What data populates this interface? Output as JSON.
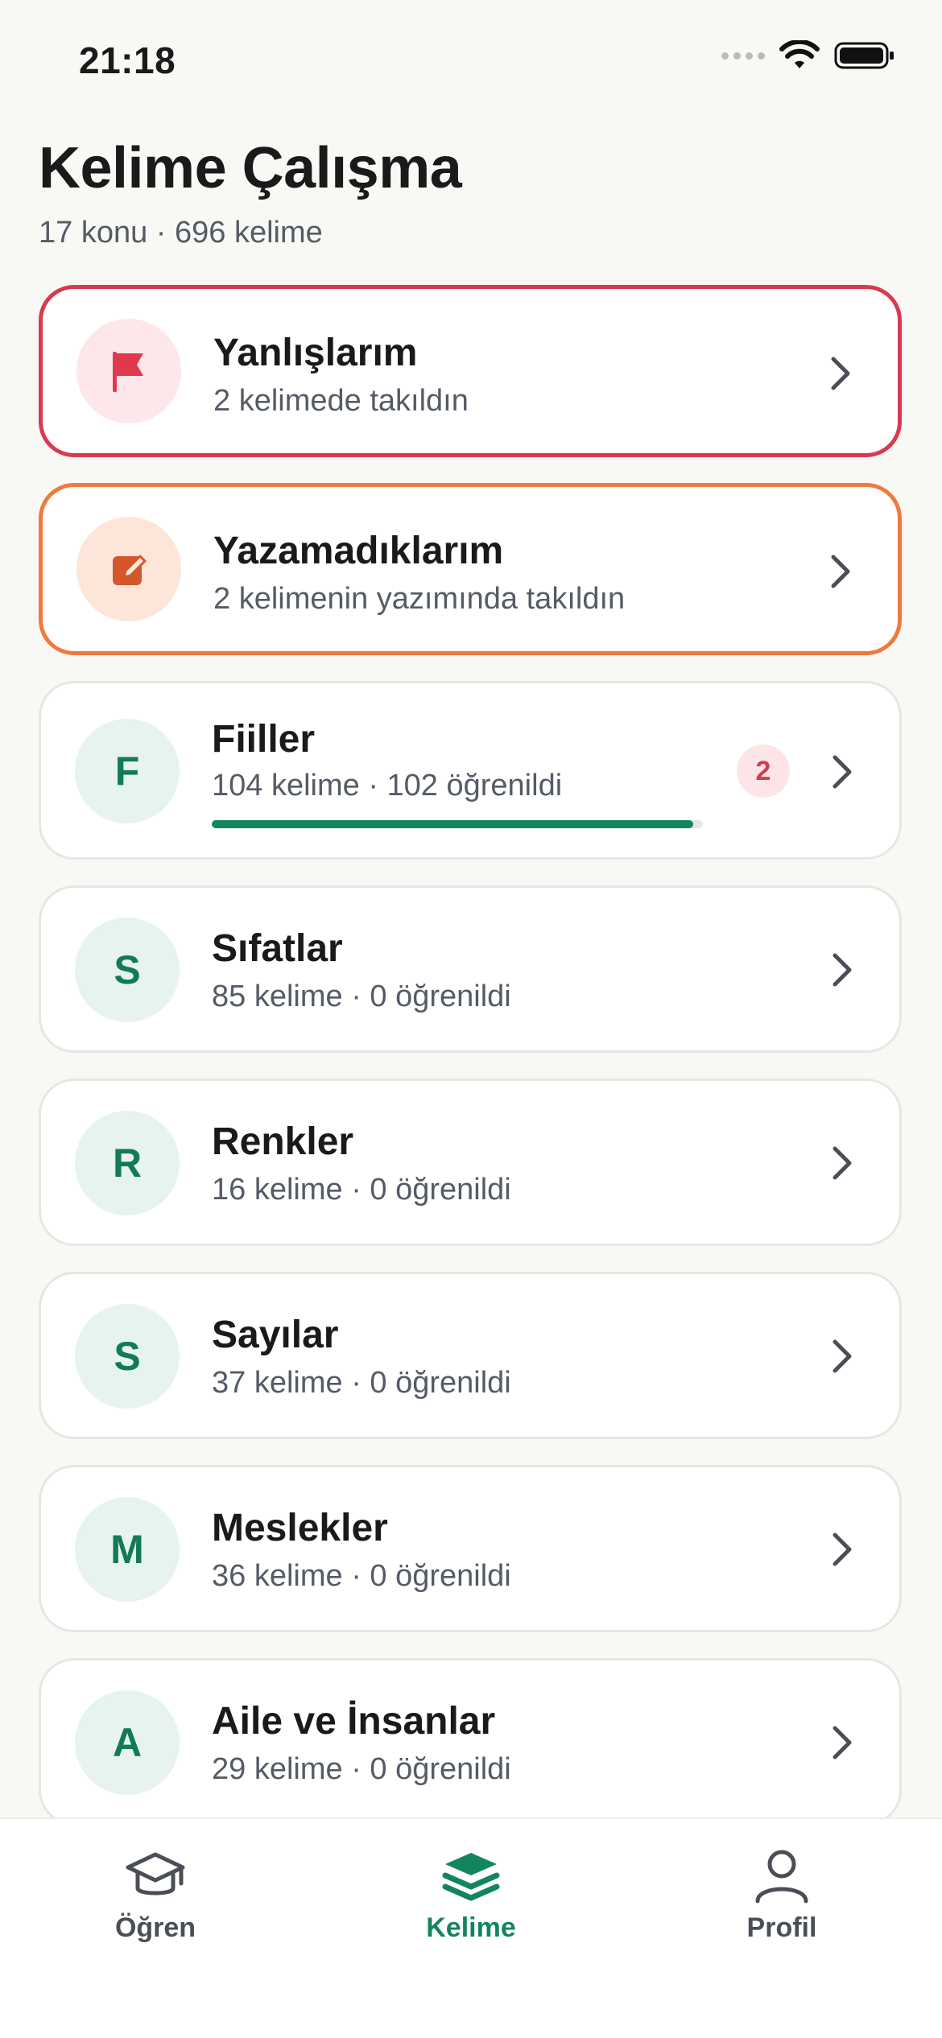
{
  "status_bar": {
    "time": "21:18"
  },
  "header": {
    "title": "Kelime Çalışma",
    "subtitle": "17 konu · 696 kelime"
  },
  "special_cards": [
    {
      "title": "Yanlışlarım",
      "subtitle": "2 kelimede takıldın",
      "icon": "flag-icon",
      "accent": "#d93a4f"
    },
    {
      "title": "Yazamadıklarım",
      "subtitle": "2 kelimenin yazımında takıldın",
      "icon": "edit-icon",
      "accent": "#ef7a3e"
    }
  ],
  "topics": [
    {
      "letter": "F",
      "title": "Fiiller",
      "subtitle": "104 kelime · 102 öğrenildi",
      "badge": "2",
      "progress": 0.98
    },
    {
      "letter": "S",
      "title": "Sıfatlar",
      "subtitle": "85 kelime · 0 öğrenildi"
    },
    {
      "letter": "R",
      "title": "Renkler",
      "subtitle": "16 kelime · 0 öğrenildi"
    },
    {
      "letter": "S",
      "title": "Sayılar",
      "subtitle": "37 kelime · 0 öğrenildi"
    },
    {
      "letter": "M",
      "title": "Meslekler",
      "subtitle": "36 kelime · 0 öğrenildi"
    },
    {
      "letter": "A",
      "title": "Aile ve İnsanlar",
      "subtitle": "29 kelime · 0 öğrenildi"
    }
  ],
  "tabs": [
    {
      "label": "Öğren",
      "icon": "graduation-cap-icon",
      "active": false
    },
    {
      "label": "Kelime",
      "icon": "layers-icon",
      "active": true
    },
    {
      "label": "Profil",
      "icon": "user-icon",
      "active": false
    }
  ],
  "colors": {
    "primary": "#13855c",
    "error": "#d93a4f",
    "warning": "#ef7a3e",
    "background": "#f8f8f5"
  }
}
